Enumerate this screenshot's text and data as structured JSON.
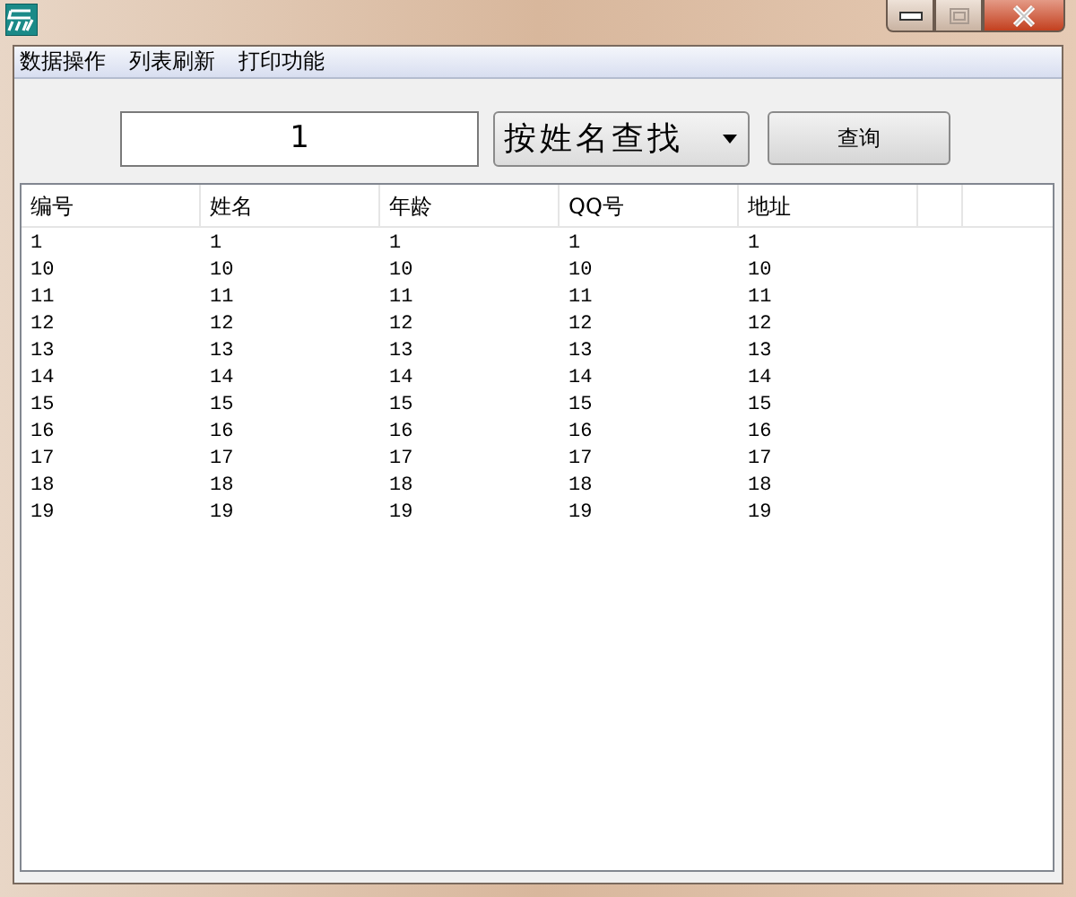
{
  "window": {
    "maximize_disabled": true
  },
  "menu": [
    "数据操作",
    "列表刷新",
    "打印功能"
  ],
  "search": {
    "value": "1"
  },
  "mode_select": {
    "value": "按姓名查找"
  },
  "query_button": "查询",
  "table": {
    "columns": [
      "编号",
      "姓名",
      "年龄",
      "QQ号",
      "地址"
    ],
    "rows": [
      [
        "1",
        "1",
        "1",
        "1",
        "1"
      ],
      [
        "10",
        "10",
        "10",
        "10",
        "10"
      ],
      [
        "11",
        "11",
        "11",
        "11",
        "11"
      ],
      [
        "12",
        "12",
        "12",
        "12",
        "12"
      ],
      [
        "13",
        "13",
        "13",
        "13",
        "13"
      ],
      [
        "14",
        "14",
        "14",
        "14",
        "14"
      ],
      [
        "15",
        "15",
        "15",
        "15",
        "15"
      ],
      [
        "16",
        "16",
        "16",
        "16",
        "16"
      ],
      [
        "17",
        "17",
        "17",
        "17",
        "17"
      ],
      [
        "18",
        "18",
        "18",
        "18",
        "18"
      ],
      [
        "19",
        "19",
        "19",
        "19",
        "19"
      ]
    ]
  }
}
